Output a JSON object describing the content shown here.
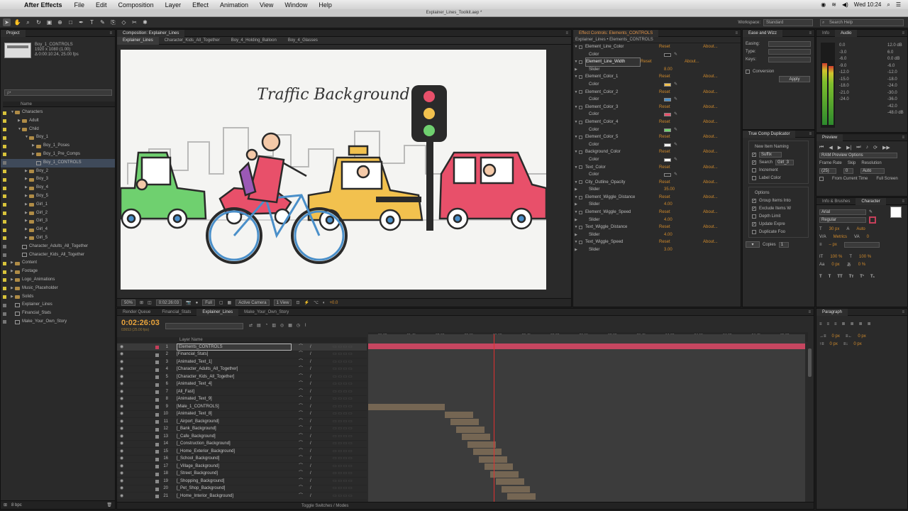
{
  "menubar": {
    "app": "After Effects",
    "items": [
      "File",
      "Edit",
      "Composition",
      "Layer",
      "Effect",
      "Animation",
      "View",
      "Window",
      "Help"
    ],
    "clock": "Wed 10:24"
  },
  "window_title": "Explainer_Lines_Toolkit.aep *",
  "toolbar": {
    "workspace_label": "Workspace:",
    "workspace_value": "Standard",
    "search_placeholder": "Search Help"
  },
  "project": {
    "tab": "Project",
    "selected_name": "Boy_1_CONTROLS",
    "selected_info1": "1920 x 1080 (1.00)",
    "selected_info2": "Δ 0:00:10:24, 25.00 fps",
    "search_placeholder": "ρ•",
    "col_name": "Name",
    "items": [
      {
        "label": "Characters",
        "indent": 0,
        "kind": "folder",
        "open": true,
        "color": "#d8c33a"
      },
      {
        "label": "Adult",
        "indent": 1,
        "kind": "folder",
        "open": false,
        "color": "#d8c33a"
      },
      {
        "label": "Child",
        "indent": 1,
        "kind": "folder",
        "open": true,
        "color": "#d8c33a"
      },
      {
        "label": "Boy_1",
        "indent": 2,
        "kind": "folder",
        "open": true,
        "color": "#d8c33a"
      },
      {
        "label": "Boy_1_Poses",
        "indent": 3,
        "kind": "folder",
        "open": false,
        "color": "#d8c33a"
      },
      {
        "label": "Boy_1_Pre_Comps",
        "indent": 3,
        "kind": "folder",
        "open": false,
        "color": "#d8c33a"
      },
      {
        "label": "Boy_1_CONTROLS",
        "indent": 3,
        "kind": "comp",
        "open": false,
        "color": "#777777"
      },
      {
        "label": "Boy_2",
        "indent": 2,
        "kind": "folder",
        "open": false,
        "color": "#d8c33a"
      },
      {
        "label": "Boy_3",
        "indent": 2,
        "kind": "folder",
        "open": false,
        "color": "#d8c33a"
      },
      {
        "label": "Boy_4",
        "indent": 2,
        "kind": "folder",
        "open": false,
        "color": "#d8c33a"
      },
      {
        "label": "Boy_5",
        "indent": 2,
        "kind": "folder",
        "open": false,
        "color": "#d8c33a"
      },
      {
        "label": "Girl_1",
        "indent": 2,
        "kind": "folder",
        "open": false,
        "color": "#d8c33a"
      },
      {
        "label": "Girl_2",
        "indent": 2,
        "kind": "folder",
        "open": false,
        "color": "#d8c33a"
      },
      {
        "label": "Girl_3",
        "indent": 2,
        "kind": "folder",
        "open": false,
        "color": "#d8c33a"
      },
      {
        "label": "Girl_4",
        "indent": 2,
        "kind": "folder",
        "open": false,
        "color": "#d8c33a"
      },
      {
        "label": "Girl_5",
        "indent": 2,
        "kind": "folder",
        "open": false,
        "color": "#d8c33a"
      },
      {
        "label": "Character_Adults_All_Together",
        "indent": 1,
        "kind": "comp",
        "open": false,
        "color": "#777777"
      },
      {
        "label": "Character_Kids_All_Together",
        "indent": 1,
        "kind": "comp",
        "open": false,
        "color": "#777777"
      },
      {
        "label": "Content",
        "indent": 0,
        "kind": "folder",
        "open": false,
        "color": "#d8c33a"
      },
      {
        "label": "Footage",
        "indent": 0,
        "kind": "folder",
        "open": false,
        "color": "#d8c33a"
      },
      {
        "label": "Logo_Animations",
        "indent": 0,
        "kind": "folder",
        "open": false,
        "color": "#d8c33a"
      },
      {
        "label": "Music_Placeholder",
        "indent": 0,
        "kind": "folder",
        "open": false,
        "color": "#d8c33a"
      },
      {
        "label": "Solids",
        "indent": 0,
        "kind": "folder",
        "open": false,
        "color": "#d8c33a"
      },
      {
        "label": "Explainer_Lines",
        "indent": 0,
        "kind": "comp",
        "open": false,
        "color": "#777777"
      },
      {
        "label": "Financial_Stats",
        "indent": 0,
        "kind": "comp",
        "open": false,
        "color": "#777777"
      },
      {
        "label": "Make_Your_Own_Story",
        "indent": 0,
        "kind": "comp",
        "open": false,
        "color": "#777777"
      }
    ],
    "footer_bpc": "8 bpc"
  },
  "composition": {
    "tab": "Composition: Explainer_Lines",
    "subtabs": [
      "Explainer_Lines",
      "Character_Kids_All_Together",
      "Boy_4_Holding_Balloon",
      "Boy_4_Glasses"
    ],
    "canvas_title": "Traffic Background",
    "zoom": "50%",
    "timecode": "0:02:26:03",
    "resolution": "Full",
    "camera": "Active Camera",
    "views": "1 View",
    "exposure": "+0.0"
  },
  "effects": {
    "tab": "Effect Controls: Elements_CONTROLS",
    "subtitle": "Explainer_Lines • Elements_CONTROLS",
    "reset": "Reset",
    "about": "About...",
    "rows": [
      {
        "name": "Element_Line_Color",
        "sub": "Color",
        "type": "color",
        "value": "#1e1e1e"
      },
      {
        "name": "Element_Line_Width",
        "sub": "Slider",
        "type": "num",
        "value": "8.00",
        "hl": true
      },
      {
        "name": "Element_Color_1",
        "sub": "Color",
        "type": "color",
        "value": "#f2c14e"
      },
      {
        "name": "Element_Color_2",
        "sub": "Color",
        "type": "color",
        "value": "#4a8fc9"
      },
      {
        "name": "Element_Color_3",
        "sub": "Color",
        "type": "color",
        "value": "#e8506a"
      },
      {
        "name": "Element_Color_4",
        "sub": "Color",
        "type": "color",
        "value": "#6fd06f"
      },
      {
        "name": "Element_Color_5",
        "sub": "Color",
        "type": "color",
        "value": "#f4f4f4"
      },
      {
        "name": "Background_Color",
        "sub": "Color",
        "type": "color",
        "value": "#ffffff"
      },
      {
        "name": "Text_Color",
        "sub": "Color",
        "type": "color",
        "value": "#2a2a2a"
      },
      {
        "name": "City_Outline_Opacity",
        "sub": "Slider",
        "type": "num",
        "value": "35.00"
      },
      {
        "name": "Element_Wiggle_Distance",
        "sub": "Slider",
        "type": "num",
        "value": "4.00"
      },
      {
        "name": "Element_Wiggle_Speed",
        "sub": "Slider",
        "type": "num",
        "value": "4.00"
      },
      {
        "name": "Text_Wiggle_Distance",
        "sub": "Slider",
        "type": "num",
        "value": "4.00"
      },
      {
        "name": "Text_Wiggle_Speed",
        "sub": "Slider",
        "type": "num",
        "value": "3.00"
      }
    ]
  },
  "ease": {
    "tab": "Ease and Wizz",
    "easing": "Easing:",
    "type": "Type:",
    "keys": "Keys:",
    "conversion": "Conversion",
    "apply": "Apply"
  },
  "truecomp": {
    "tab": "True Comp Duplicator",
    "naming": "New Item Naming",
    "suffix": "Suffix",
    "search": "Search",
    "search_val": "Girl_3",
    "increment": "Increment",
    "label_color": "Label Color",
    "options": "Options",
    "opt_items": [
      "Group Items Into",
      "Exclude Items W",
      "Depth Limit",
      "Update Expre",
      "Duplicate Foo"
    ],
    "opt_checked": [
      true,
      true,
      false,
      true,
      false
    ],
    "copies": "Copies",
    "copies_val": "1"
  },
  "audio": {
    "tabs": [
      "Info",
      "Audio"
    ],
    "left": [
      "0.0",
      "-3.0",
      "-6.0",
      "-9.0",
      "-12.0",
      "-15.0",
      "-18.0",
      "-21.0",
      "-24.0"
    ],
    "right": [
      "12.0 dB",
      "6.0",
      "0.0 dB",
      "-6.0",
      "-12.0",
      "-18.0",
      "-24.0",
      "-30.0",
      "-36.0",
      "-42.0",
      "-48.0 dB"
    ],
    "levels": [
      0.78,
      0.74
    ]
  },
  "preview": {
    "tab": "Preview",
    "ram": "RAM Preview Options",
    "frame_rate": "Frame Rate",
    "skip": "Skip",
    "resolution": "Resolution",
    "fps": "(25)",
    "skip_val": "0",
    "res_val": "Auto",
    "from_current": "From Current Time",
    "full_screen": "Full Screen"
  },
  "character": {
    "tabs": [
      "Info & Brushes",
      "Character"
    ],
    "font": "Arial",
    "style": "Regular",
    "size": "30 px",
    "leading": "Auto",
    "tracking": "0",
    "stroke": "– px",
    "scale_v": "100 %",
    "scale_h": "100 %",
    "baseline": "0 px",
    "tsume": "0 %"
  },
  "timeline": {
    "tabs": [
      "Render Queue",
      "Financial_Stats",
      "Explainer_Lines",
      "Make_Your_Own_Story"
    ],
    "active_tab": 2,
    "timecode": "0:02:26:03",
    "frames": "03653 (25.00 fps)",
    "search_placeholder": "ρ•",
    "col_layer": "Layer Name",
    "ruler": [
      "01:30s",
      "01:45s",
      "02:00s",
      "02:15s",
      "02:30s",
      "02:45s",
      "03:00s",
      "03:15s",
      "03:30s",
      "03:45s",
      "04:00s",
      "04:15s",
      "04:30s",
      "04:45s",
      "05:00s"
    ],
    "cti_fraction": 0.3,
    "footer": "Toggle Switches / Modes",
    "layers": [
      {
        "n": "1",
        "name": "Elements_CONTROLS",
        "color": "#c63f5a",
        "sel": true
      },
      {
        "n": "2",
        "name": "[Financial_Stats]",
        "color": "#8a8a8a"
      },
      {
        "n": "3",
        "name": "[Animated_Text_1]",
        "color": "#8a8a8a"
      },
      {
        "n": "4",
        "name": "[Character_Adults_All_Together]",
        "color": "#8a8a8a"
      },
      {
        "n": "5",
        "name": "[Character_Kids_All_Together]",
        "color": "#8a8a8a"
      },
      {
        "n": "6",
        "name": "[Animated_Text_4]",
        "color": "#8a8a8a"
      },
      {
        "n": "7",
        "name": "[All_Fast]",
        "color": "#8a8a8a"
      },
      {
        "n": "8",
        "name": "[Animated_Text_9]",
        "color": "#8a8a8a"
      },
      {
        "n": "9",
        "name": "[Male_1_CONTROLS]",
        "color": "#8a8a8a"
      },
      {
        "n": "10",
        "name": "[Animated_Text_8]",
        "color": "#8a8a8a"
      },
      {
        "n": "11",
        "name": "[_Airport_Background]",
        "color": "#8a8a8a"
      },
      {
        "n": "12",
        "name": "[_Bank_Background]",
        "color": "#8a8a8a"
      },
      {
        "n": "13",
        "name": "[_Cafe_Background]",
        "color": "#8a8a8a"
      },
      {
        "n": "14",
        "name": "[_Construction_Background]",
        "color": "#8a8a8a"
      },
      {
        "n": "15",
        "name": "[_Home_Exterior_Background]",
        "color": "#8a8a8a"
      },
      {
        "n": "16",
        "name": "[_School_Background]",
        "color": "#8a8a8a"
      },
      {
        "n": "17",
        "name": "[_Village_Background]",
        "color": "#8a8a8a"
      },
      {
        "n": "18",
        "name": "[_Street_Background]",
        "color": "#8a8a8a"
      },
      {
        "n": "19",
        "name": "[_Shopping_Background]",
        "color": "#8a8a8a"
      },
      {
        "n": "20",
        "name": "[_Pet_Shop_Background]",
        "color": "#8a8a8a"
      },
      {
        "n": "21",
        "name": "[_Home_Interior_Background]",
        "color": "#8a8a8a"
      }
    ]
  },
  "paragraph": {
    "tab": "Paragraph",
    "indent1": "0 px",
    "indent2": "0 px",
    "indent3": "0 px",
    "space1": "0 px",
    "space2": "0 px"
  }
}
